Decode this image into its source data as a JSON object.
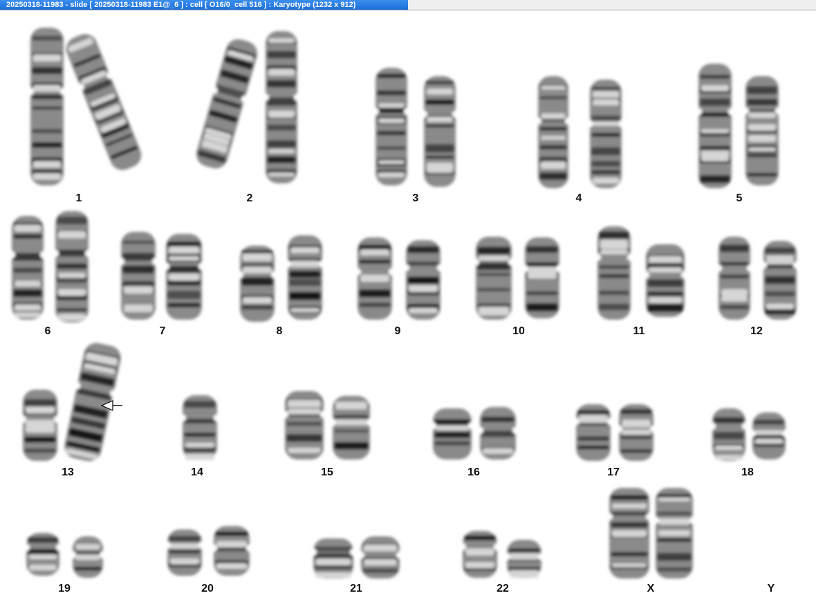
{
  "window": {
    "title": "20250318-11983 - slide [ 20250318-11983 E1@_6 ] : cell [ O16/0_cell 516 ] : Karyotype  (1232 x 912)"
  },
  "colors": {
    "title_bar": "#1c6fd8",
    "chromosome_dark": "#1a1a1a",
    "background": "#ffffff"
  },
  "karyotype": {
    "annotation_icon": "arrow-left-icon",
    "annotated_chromosome": "13",
    "groups": [
      {
        "label": "1"
      },
      {
        "label": "2"
      },
      {
        "label": "3"
      },
      {
        "label": "4"
      },
      {
        "label": "5"
      },
      {
        "label": "6"
      },
      {
        "label": "7"
      },
      {
        "label": "8"
      },
      {
        "label": "9"
      },
      {
        "label": "10"
      },
      {
        "label": "11"
      },
      {
        "label": "12"
      },
      {
        "label": "13"
      },
      {
        "label": "14"
      },
      {
        "label": "15"
      },
      {
        "label": "16"
      },
      {
        "label": "17"
      },
      {
        "label": "18"
      },
      {
        "label": "19"
      },
      {
        "label": "20"
      },
      {
        "label": "21"
      },
      {
        "label": "22"
      },
      {
        "label": "X"
      },
      {
        "label": "Y"
      }
    ]
  }
}
